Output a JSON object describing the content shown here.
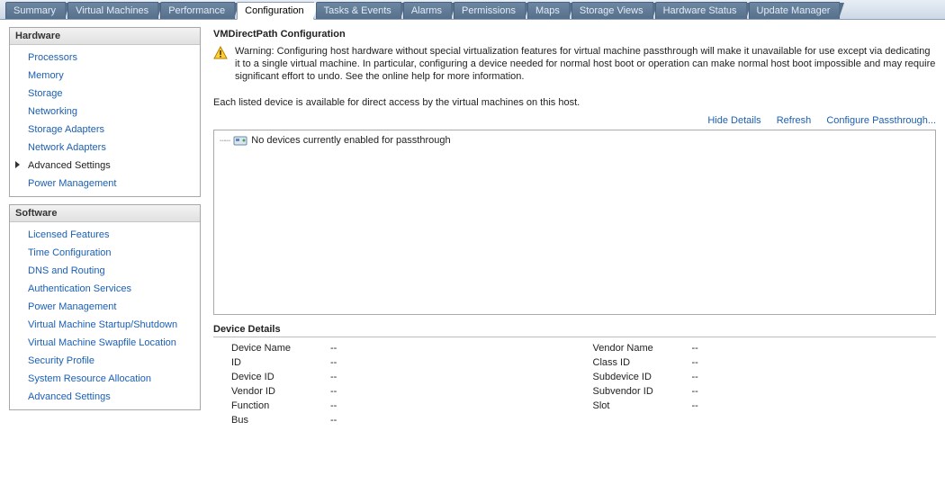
{
  "tabs": [
    {
      "label": "Summary"
    },
    {
      "label": "Virtual Machines"
    },
    {
      "label": "Performance"
    },
    {
      "label": "Configuration",
      "active": true
    },
    {
      "label": "Tasks & Events"
    },
    {
      "label": "Alarms"
    },
    {
      "label": "Permissions"
    },
    {
      "label": "Maps"
    },
    {
      "label": "Storage Views"
    },
    {
      "label": "Hardware Status"
    },
    {
      "label": "Update Manager"
    }
  ],
  "sidebar": {
    "hardware": {
      "title": "Hardware",
      "items": [
        {
          "label": "Processors"
        },
        {
          "label": "Memory"
        },
        {
          "label": "Storage"
        },
        {
          "label": "Networking"
        },
        {
          "label": "Storage Adapters"
        },
        {
          "label": "Network Adapters"
        },
        {
          "label": "Advanced Settings",
          "current": true
        },
        {
          "label": "Power Management"
        }
      ]
    },
    "software": {
      "title": "Software",
      "items": [
        {
          "label": "Licensed Features"
        },
        {
          "label": "Time Configuration"
        },
        {
          "label": "DNS and Routing"
        },
        {
          "label": "Authentication Services"
        },
        {
          "label": "Power Management"
        },
        {
          "label": "Virtual Machine Startup/Shutdown"
        },
        {
          "label": "Virtual Machine Swapfile Location"
        },
        {
          "label": "Security Profile"
        },
        {
          "label": "System Resource Allocation"
        },
        {
          "label": "Advanced Settings"
        }
      ]
    }
  },
  "content": {
    "title": "VMDirectPath Configuration",
    "warning": "Warning: Configuring host hardware without special virtualization features for virtual machine passthrough will make it unavailable for use except via dedicating it to a single virtual machine. In particular, configuring a device needed for normal host boot or operation can make normal host boot impossible and may require significant effort to undo. See the online help for more information.",
    "description": "Each listed device is available for direct access by the virtual machines on this host.",
    "actions": {
      "hide": "Hide Details",
      "refresh": "Refresh",
      "configure": "Configure Passthrough..."
    },
    "device_tree": {
      "message": "No devices currently enabled for passthrough"
    },
    "details_title": "Device Details",
    "details_left": [
      {
        "label": "Device Name",
        "value": "--"
      },
      {
        "label": "ID",
        "value": "--"
      },
      {
        "label": "Device ID",
        "value": "--"
      },
      {
        "label": "Vendor ID",
        "value": "--"
      },
      {
        "label": "Function",
        "value": "--"
      },
      {
        "label": "Bus",
        "value": "--"
      }
    ],
    "details_right": [
      {
        "label": "Vendor Name",
        "value": "--"
      },
      {
        "label": "Class ID",
        "value": "--"
      },
      {
        "label": "Subdevice ID",
        "value": "--"
      },
      {
        "label": "Subvendor ID",
        "value": "--"
      },
      {
        "label": "Slot",
        "value": "--"
      }
    ]
  }
}
